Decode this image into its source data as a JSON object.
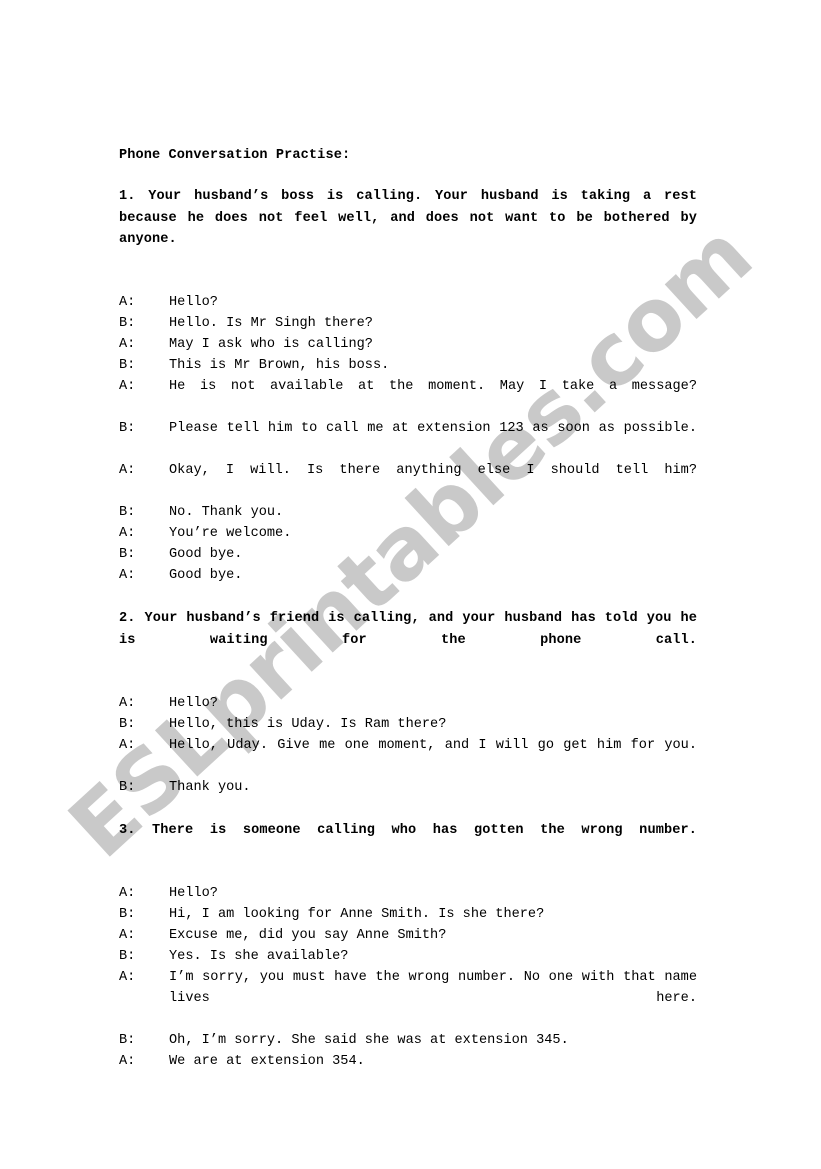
{
  "document": {
    "title": "Phone Conversation Practise:",
    "watermark": {
      "text": "ESLprintables.com",
      "color": "#c9c9c9"
    },
    "sections": [
      {
        "number": "1.",
        "heading": "1. Your husband’s boss is calling. Your husband is taking a rest because he does not feel well, and does not want to be bothered by anyone.",
        "dialogue": [
          {
            "speaker": "A:",
            "text": "Hello?",
            "wraps": false
          },
          {
            "speaker": "B:",
            "text": "Hello. Is Mr Singh there?",
            "wraps": false
          },
          {
            "speaker": "A:",
            "text": "May I ask who is calling?",
            "wraps": false
          },
          {
            "speaker": "B:",
            "text": "This is Mr Brown, his boss.",
            "wraps": false
          },
          {
            "speaker": "A:",
            "text": "He is not available at the moment. May I take a message?",
            "wraps": true
          },
          {
            "speaker": "B:",
            "text": "Please tell him to call me at extension 123 as soon as possible.",
            "wraps": true
          },
          {
            "speaker": "A:",
            "text": "Okay, I will. Is there anything else I should tell him?",
            "wraps": true
          },
          {
            "speaker": "B:",
            "text": "No. Thank you.",
            "wraps": false
          },
          {
            "speaker": "A:",
            "text": "You’re welcome.",
            "wraps": false
          },
          {
            "speaker": "B:",
            "text": "Good bye.",
            "wraps": false
          },
          {
            "speaker": "A:",
            "text": "Good bye.",
            "wraps": false
          }
        ]
      },
      {
        "number": "2.",
        "heading": "2. Your husband’s friend is calling, and your husband has told you he is waiting for the phone call.",
        "dialogue": [
          {
            "speaker": "A:",
            "text": "Hello?",
            "wraps": false
          },
          {
            "speaker": "B:",
            "text": "Hello, this is Uday. Is Ram there?",
            "wraps": false
          },
          {
            "speaker": "A:",
            "text": "Hello, Uday. Give me one moment, and I will go get him for you.",
            "wraps": true
          },
          {
            "speaker": "B:",
            "text": "Thank you.",
            "wraps": false
          }
        ]
      },
      {
        "number": "3.",
        "heading": "3.  There is someone calling who has gotten the wrong number.",
        "dialogue": [
          {
            "speaker": "A:",
            "text": "Hello?",
            "wraps": false
          },
          {
            "speaker": "B:",
            "text": "Hi, I am looking for Anne Smith. Is she there?",
            "wraps": false
          },
          {
            "speaker": "A:",
            "text": "Excuse me, did you say Anne Smith?",
            "wraps": false
          },
          {
            "speaker": "B:",
            "text": "Yes. Is she available?",
            "wraps": false
          },
          {
            "speaker": "A:",
            "text": "I’m sorry, you must have the wrong number. No one with that name lives here.",
            "wraps": true
          },
          {
            "speaker": "B:",
            "text": "Oh, I’m sorry. She said she was at extension 345.",
            "wraps": false
          },
          {
            "speaker": "A:",
            "text": "We are at extension 354.",
            "wraps": false
          }
        ]
      }
    ]
  }
}
